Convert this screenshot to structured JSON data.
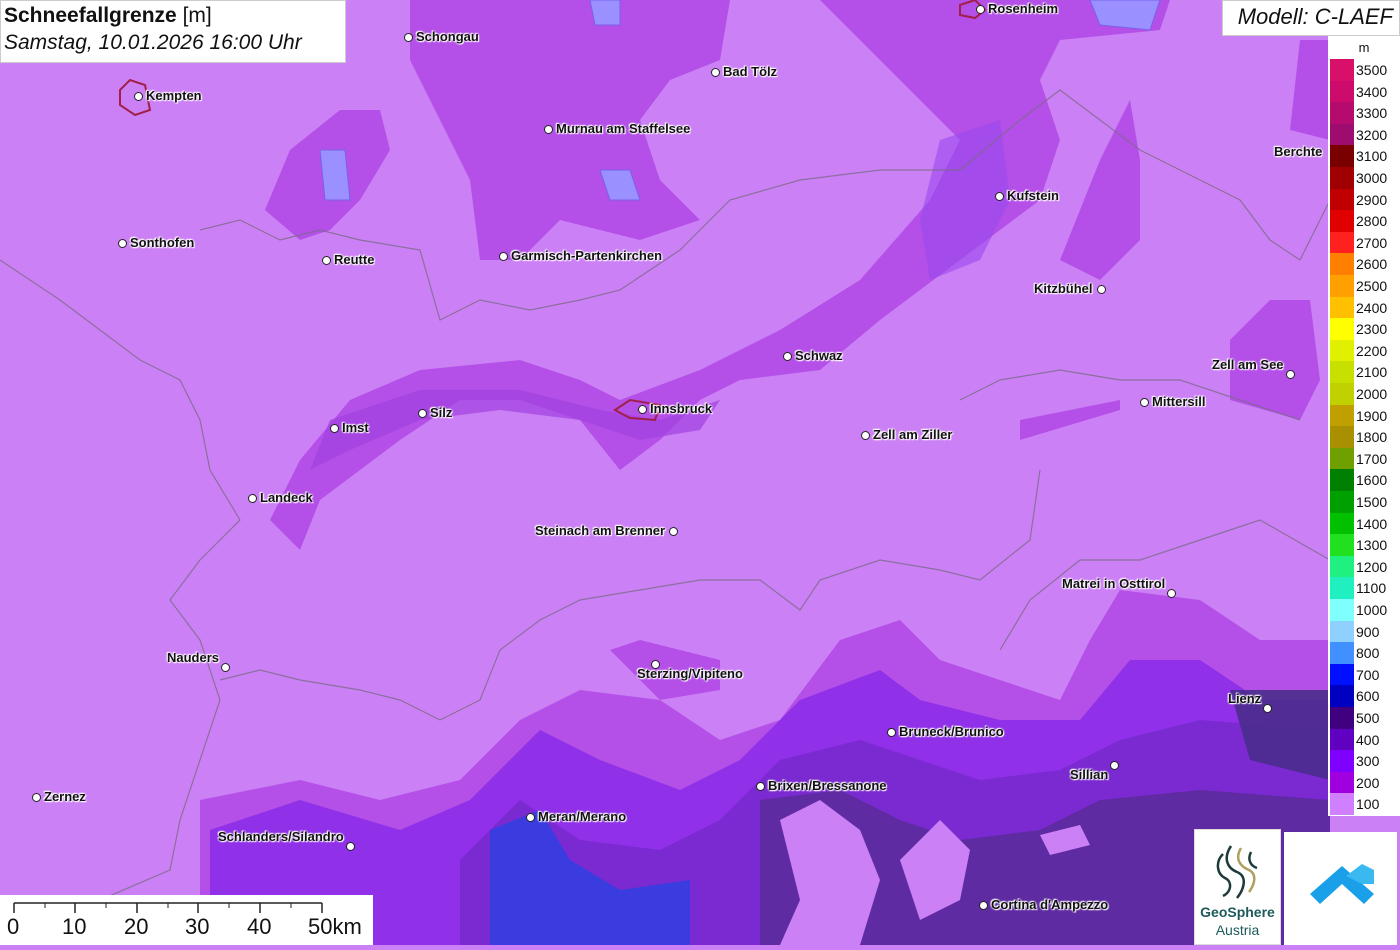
{
  "title": {
    "main": "Schneefallgrenze",
    "unit": "[m]",
    "datetime": "Samstag, 10.01.2026 16:00 Uhr"
  },
  "model": "Modell: C-LAEF",
  "legend": {
    "unit": "m",
    "levels": [
      {
        "label": "3500",
        "color": "#d8106a"
      },
      {
        "label": "3400",
        "color": "#cc0b6c"
      },
      {
        "label": "3300",
        "color": "#b50a6e"
      },
      {
        "label": "3200",
        "color": "#9e0c70"
      },
      {
        "label": "3100",
        "color": "#7a0000"
      },
      {
        "label": "3000",
        "color": "#a00000"
      },
      {
        "label": "2900",
        "color": "#c00000"
      },
      {
        "label": "2800",
        "color": "#e00000"
      },
      {
        "label": "2700",
        "color": "#ff2020"
      },
      {
        "label": "2600",
        "color": "#ff8000"
      },
      {
        "label": "2500",
        "color": "#ffa000"
      },
      {
        "label": "2400",
        "color": "#ffc000"
      },
      {
        "label": "2300",
        "color": "#ffff00"
      },
      {
        "label": "2200",
        "color": "#e0f000"
      },
      {
        "label": "2100",
        "color": "#c8e000"
      },
      {
        "label": "2000",
        "color": "#c0d000"
      },
      {
        "label": "1900",
        "color": "#c0a000"
      },
      {
        "label": "1800",
        "color": "#a89000"
      },
      {
        "label": "1700",
        "color": "#70a000"
      },
      {
        "label": "1600",
        "color": "#008000"
      },
      {
        "label": "1500",
        "color": "#00a000"
      },
      {
        "label": "1400",
        "color": "#00c000"
      },
      {
        "label": "1300",
        "color": "#20e020"
      },
      {
        "label": "1200",
        "color": "#20f080"
      },
      {
        "label": "1100",
        "color": "#20f0c0"
      },
      {
        "label": "1000",
        "color": "#80ffff"
      },
      {
        "label": "900",
        "color": "#90d0ff"
      },
      {
        "label": "800",
        "color": "#4090ff"
      },
      {
        "label": "700",
        "color": "#0010ff"
      },
      {
        "label": "600",
        "color": "#0000c0"
      },
      {
        "label": "500",
        "color": "#400080"
      },
      {
        "label": "400",
        "color": "#6000c0"
      },
      {
        "label": "300",
        "color": "#8000ff"
      },
      {
        "label": "200",
        "color": "#a000e0"
      },
      {
        "label": "100",
        "color": "#d080ff"
      }
    ]
  },
  "scale": {
    "labels": [
      "0",
      "10",
      "20",
      "30",
      "40",
      "50km"
    ]
  },
  "logos": {
    "geosphere_line1": "GeoSphere",
    "geosphere_line2": "Austria"
  },
  "cities": [
    {
      "id": "rosenheim",
      "name": "Rosenheim"
    },
    {
      "id": "schongau",
      "name": "Schongau"
    },
    {
      "id": "kempten",
      "name": "Kempten"
    },
    {
      "id": "bad-toelz",
      "name": "Bad Tölz"
    },
    {
      "id": "murnau",
      "name": "Murnau am Staffelsee"
    },
    {
      "id": "berchtesgaden",
      "name": "Berchte"
    },
    {
      "id": "kufstein",
      "name": "Kufstein"
    },
    {
      "id": "sonthofen",
      "name": "Sonthofen"
    },
    {
      "id": "reutte",
      "name": "Reutte"
    },
    {
      "id": "garmisch",
      "name": "Garmisch-Partenkirchen"
    },
    {
      "id": "kitzbuehel",
      "name": "Kitzbühel"
    },
    {
      "id": "schwaz",
      "name": "Schwaz"
    },
    {
      "id": "zell-am-see",
      "name": "Zell am See"
    },
    {
      "id": "mittersill",
      "name": "Mittersill"
    },
    {
      "id": "innsbruck",
      "name": "Innsbruck"
    },
    {
      "id": "silz",
      "name": "Silz"
    },
    {
      "id": "imst",
      "name": "Imst"
    },
    {
      "id": "zell-am-ziller",
      "name": "Zell am Ziller"
    },
    {
      "id": "landeck",
      "name": "Landeck"
    },
    {
      "id": "steinach",
      "name": "Steinach am Brenner"
    },
    {
      "id": "matrei",
      "name": "Matrei in Osttirol"
    },
    {
      "id": "nauders",
      "name": "Nauders"
    },
    {
      "id": "sterzing",
      "name": "Sterzing/Vipiteno"
    },
    {
      "id": "lienz",
      "name": "Lienz"
    },
    {
      "id": "bruneck",
      "name": "Bruneck/Brunico"
    },
    {
      "id": "sillian",
      "name": "Sillian"
    },
    {
      "id": "brixen",
      "name": "Brixen/Bressanone"
    },
    {
      "id": "zernez",
      "name": "Zernez"
    },
    {
      "id": "meran",
      "name": "Meran/Merano"
    },
    {
      "id": "schlanders",
      "name": "Schlanders/Silandro"
    },
    {
      "id": "cortina",
      "name": "Cortina d'Ampezzo"
    }
  ]
}
